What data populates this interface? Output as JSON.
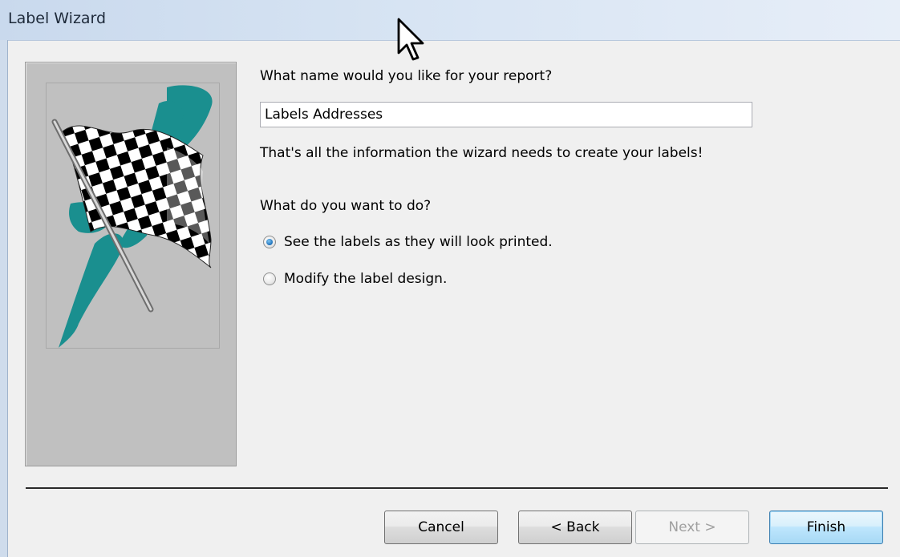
{
  "window": {
    "title": "Label Wizard"
  },
  "form": {
    "name_prompt": "What name would you like for your report?",
    "report_name_value": "Labels Addresses",
    "info_text": "That's all the information the wizard needs to create your labels!",
    "action_prompt": "What do you want to do?",
    "options": [
      {
        "label": "See the labels as they will look printed.",
        "checked": true
      },
      {
        "label": "Modify the label design.",
        "checked": false
      }
    ]
  },
  "buttons": {
    "cancel": "Cancel",
    "back": "< Back",
    "next": "Next >",
    "finish": "Finish"
  },
  "colors": {
    "flag_accent": "#1a8f8f",
    "radio_selected": "#1d6fb9",
    "default_button_border": "#3c7fb1"
  },
  "icons": {
    "wizard_art": "checkered-flag-icon",
    "pointer": "mouse-cursor-icon"
  }
}
